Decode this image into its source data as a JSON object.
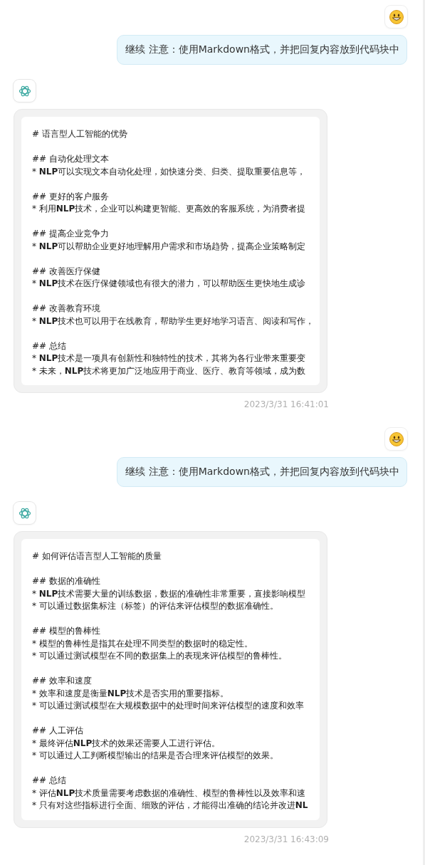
{
  "messages": [
    {
      "kind": "user",
      "text": "继续 注意：使用Markdown格式，并把回复内容放到代码块中"
    },
    {
      "kind": "assistant",
      "timestamp": "2023/3/31 16:41:01",
      "code": {
        "title": "# 语言型人工智能的优势",
        "sections": [
          {
            "heading": "## 自动化处理文本",
            "bullets": [
              "* **NLP**可以实现文本自动化处理，如快速分类、归类、提取重要信息等，"
            ]
          },
          {
            "heading": "## 更好的客户服务",
            "bullets": [
              "* 利用**NLP**技术，企业可以构建更智能、更高效的客服系统，为消费者提"
            ]
          },
          {
            "heading": "## 提高企业竞争力",
            "bullets": [
              "* **NLP**可以帮助企业更好地理解用户需求和市场趋势，提高企业策略制定"
            ]
          },
          {
            "heading": "## 改善医疗保健",
            "bullets": [
              "* **NLP**技术在医疗保健领域也有很大的潜力，可以帮助医生更快地生成诊"
            ]
          },
          {
            "heading": "## 改善教育环境",
            "bullets": [
              "* **NLP**技术也可以用于在线教育，帮助学生更好地学习语言、阅读和写作，"
            ]
          },
          {
            "heading": "## 总结",
            "bullets": [
              "* **NLP**技术是一项具有创新性和独特性的技术，其将为各行业带来重要变",
              "* 未来，**NLP**技术将更加广泛地应用于商业、医疗、教育等领域，成为数"
            ]
          }
        ]
      }
    },
    {
      "kind": "user",
      "text": "继续 注意：使用Markdown格式，并把回复内容放到代码块中"
    },
    {
      "kind": "assistant",
      "timestamp": "2023/3/31 16:43:09",
      "code": {
        "title": "# 如何评估语言型人工智能的质量",
        "sections": [
          {
            "heading": "## 数据的准确性",
            "bullets": [
              "* **NLP**技术需要大量的训练数据，数据的准确性非常重要，直接影响模型",
              "* 可以通过数据集标注（标签）的评估来评估模型的数据准确性。"
            ]
          },
          {
            "heading": "## 模型的鲁棒性",
            "bullets": [
              "* 模型的鲁棒性是指其在处理不同类型的数据时的稳定性。",
              "* 可以通过测试模型在不同的数据集上的表现来评估模型的鲁棒性。"
            ]
          },
          {
            "heading": "## 效率和速度",
            "bullets": [
              "* 效率和速度是衡量**NLP**技术是否实用的重要指标。",
              "* 可以通过测试模型在大规模数据中的处理时间来评估模型的速度和效率"
            ]
          },
          {
            "heading": "## 人工评估",
            "bullets": [
              "* 最终评估**NLP**技术的效果还需要人工进行评估。",
              "* 可以通过人工判断模型输出的结果是否合理来评估模型的效果。"
            ]
          },
          {
            "heading": "## 总结",
            "bullets": [
              "* 评估**NLP**技术质量需要考虑数据的准确性、模型的鲁棒性以及效率和速",
              "* 只有对这些指标进行全面、细致的评估，才能得出准确的结论并改进**NL**"
            ]
          }
        ]
      }
    }
  ]
}
